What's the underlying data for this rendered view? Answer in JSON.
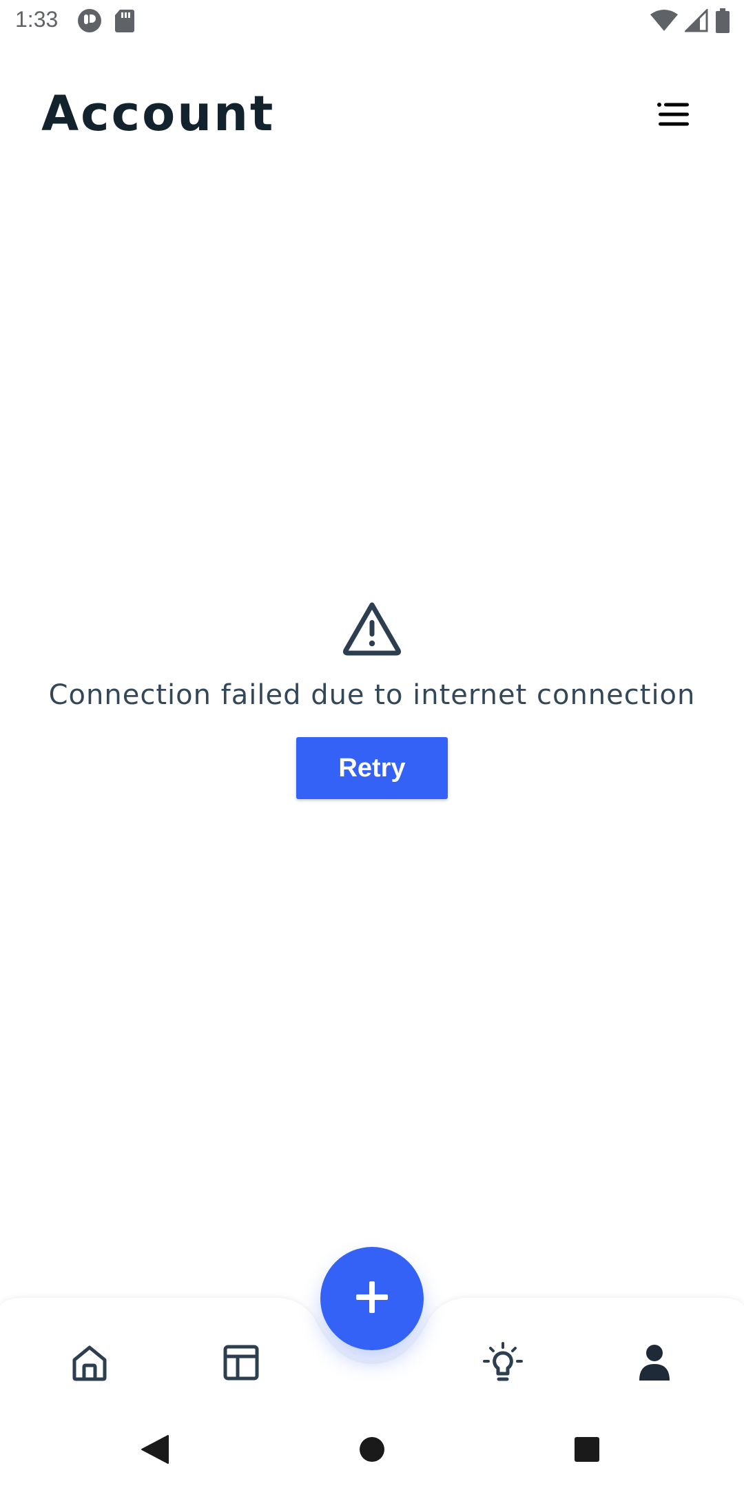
{
  "status_bar": {
    "time": "1:33",
    "left_icons": [
      "app-notification-icon",
      "sd-card-icon"
    ],
    "right_icons": [
      "wifi-icon",
      "cell-signal-icon",
      "battery-icon"
    ]
  },
  "header": {
    "title": "Account",
    "menu_icon": "menu-icon"
  },
  "error_state": {
    "icon": "warning-icon",
    "message": "Connection failed due to internet connection",
    "retry_label": "Retry"
  },
  "bottom_nav": {
    "items": [
      {
        "icon": "home-icon",
        "active": false
      },
      {
        "icon": "layout-icon",
        "active": false
      },
      {
        "icon": "lightbulb-icon",
        "active": false
      },
      {
        "icon": "person-icon",
        "active": true
      }
    ],
    "fab_icon": "plus-icon"
  },
  "system_nav": {
    "buttons": [
      "back-icon",
      "home-circle-icon",
      "recents-icon"
    ]
  },
  "colors": {
    "accent": "#3462f6",
    "title_text": "#13232d",
    "body_text": "#33475b",
    "icon": "#2c3e50"
  }
}
